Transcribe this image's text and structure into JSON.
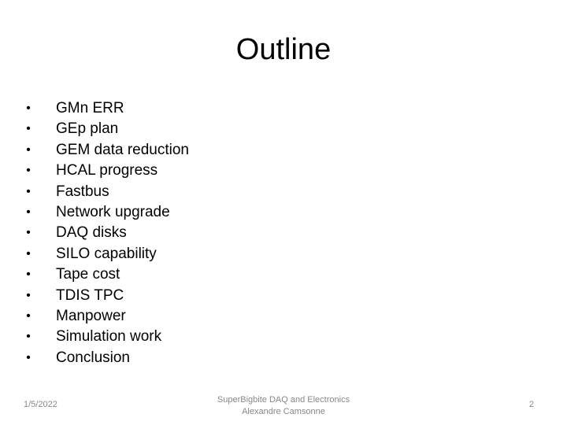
{
  "slide": {
    "title": "Outline",
    "bullet_glyph": "•",
    "items": [
      "GMn ERR",
      "GEp plan",
      "GEM data reduction",
      "HCAL progress",
      "Fastbus",
      "Network upgrade",
      "DAQ disks",
      "SILO capability",
      "Tape cost",
      "TDIS TPC",
      "Manpower",
      "Simulation work",
      "Conclusion"
    ]
  },
  "footer": {
    "date": "1/5/2022",
    "center_line1": "SuperBigbite DAQ and Electronics",
    "center_line2": "Alexandre Camsonne",
    "page_number": "2"
  }
}
